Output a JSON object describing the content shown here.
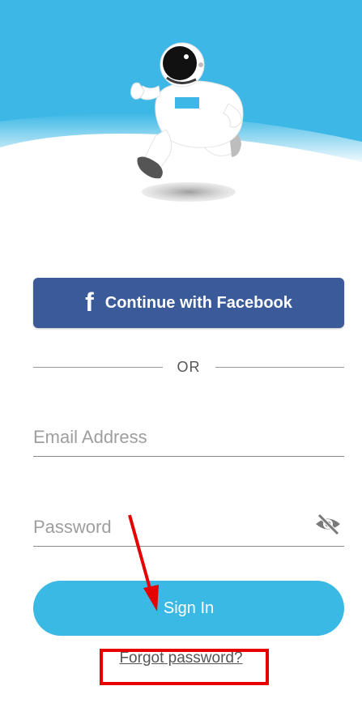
{
  "auth": {
    "facebook_label": "Continue with Facebook",
    "facebook_icon_glyph": "f",
    "divider_text": "OR",
    "email_placeholder": "Email Address",
    "password_placeholder": "Password",
    "password_toggle_icon": "eye-off-icon",
    "signin_label": "Sign In",
    "forgot_label": "Forgot password?"
  },
  "colors": {
    "sky_blue": "#3db8e6",
    "facebook_blue": "#3b5a9a",
    "primary_button": "#3bb9e5",
    "annotation_red": "#e60000"
  }
}
